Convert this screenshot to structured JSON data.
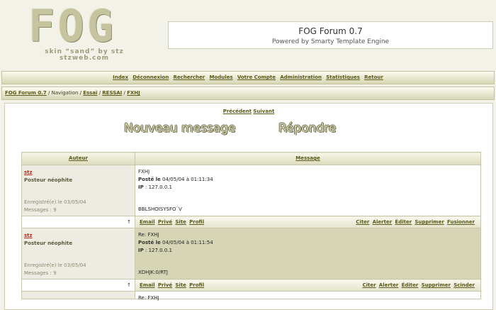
{
  "logo": {
    "text": "FOG",
    "skin": "skin “sand” by stz",
    "site": "stzweb.com"
  },
  "header": {
    "title": "FOG Forum 0.7",
    "subtitle": "Powered by Smarty Template Engine"
  },
  "nav": {
    "items": [
      "Index",
      "Déconnexion",
      "Rechercher",
      "Modules",
      "Votre Compte",
      "Administration",
      "Statistiques",
      "Retour"
    ]
  },
  "breadcrumb": {
    "forum": "FOG Forum 0.7",
    "sep1": "/",
    "navigation": "Navigation",
    "sep2": "/",
    "essai": "Essai",
    "sep3": "/",
    "ressai": "RESSAI",
    "sep4": "/",
    "topic": "FXHJ"
  },
  "pager": {
    "prev": "Précédent",
    "next": "Suivant"
  },
  "actions": {
    "new_message": "Nouveau message",
    "reply": "Répondre"
  },
  "table": {
    "col_author": "Auteur",
    "col_message": "Message"
  },
  "posts": [
    {
      "author": "stz",
      "rank": "Posteur néophite",
      "registered": "Enregistré(e) le 03/05/04",
      "messages": "Messages : 9",
      "subject": "FXHJ",
      "posted_label": "Posté le",
      "posted_value": "04/05/04 à 01:11:34",
      "ip_label": "IP",
      "ip_value": ": 127.0.0.1",
      "body": "BBLSHOISYSFO¨V",
      "tools_left": [
        "Email",
        "Privé",
        "Site",
        "Profil"
      ],
      "tools_right": [
        "Citer",
        "Alerter",
        "Éditer",
        "Supprimer",
        "Fusionner"
      ]
    },
    {
      "author": "stz",
      "rank": "Posteur néophite",
      "registered": "Enregistré(e) le 03/05/04",
      "messages": "Messages : 9",
      "subject": "Re: FXHJ",
      "posted_label": "Posté le",
      "posted_value": "04/05/04 à 01:11:54",
      "ip_label": "IP",
      "ip_value": ": 127.0.0.1",
      "body": "XDHJK:0/RTJ",
      "tools_left": [
        "Email",
        "Privé",
        "Site",
        "Profil"
      ],
      "tools_right": [
        "Citer",
        "Alerter",
        "Éditer",
        "Supprimer",
        "Scinder"
      ]
    }
  ],
  "arrow": "↑",
  "next_post_subject": "Re: FXHJ",
  "colors": {
    "background": "#f3f2e8",
    "bar": "#d7d6b4",
    "author_name": "#b52a1c",
    "alt_row": "#d6d5b6",
    "link": "#5a5a1a"
  }
}
